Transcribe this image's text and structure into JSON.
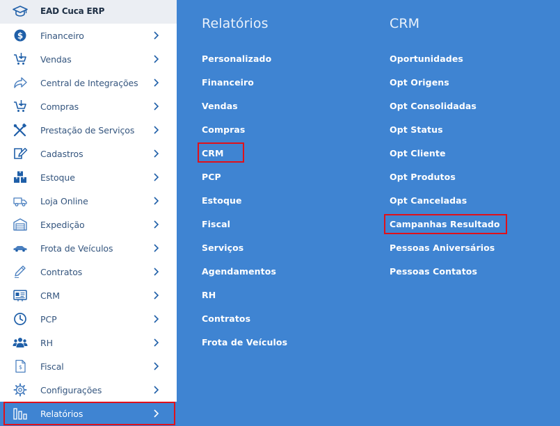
{
  "brand": {
    "title": "EAD Cuca ERP",
    "icon": "graduation-cap-icon"
  },
  "sidebar": {
    "items": [
      {
        "label": "Financeiro",
        "icon": "dollar-circle-icon"
      },
      {
        "label": "Vendas",
        "icon": "cart-arrow-icon"
      },
      {
        "label": "Central de Integrações",
        "icon": "share-arrow-icon"
      },
      {
        "label": "Compras",
        "icon": "cart-down-icon"
      },
      {
        "label": "Prestação de Serviços",
        "icon": "tools-icon"
      },
      {
        "label": "Cadastros",
        "icon": "edit-icon"
      },
      {
        "label": "Estoque",
        "icon": "boxes-icon"
      },
      {
        "label": "Loja Online",
        "icon": "truck-icon"
      },
      {
        "label": "Expedição",
        "icon": "warehouse-icon"
      },
      {
        "label": "Frota de Veículos",
        "icon": "car-icon"
      },
      {
        "label": "Contratos",
        "icon": "pen-icon"
      },
      {
        "label": "CRM",
        "icon": "id-card-icon"
      },
      {
        "label": "PCP",
        "icon": "clock-icon"
      },
      {
        "label": "RH",
        "icon": "users-icon"
      },
      {
        "label": "Fiscal",
        "icon": "document-dollar-icon"
      },
      {
        "label": "Configurações",
        "icon": "gear-icon"
      },
      {
        "label": "Relatórios",
        "icon": "bar-chart-icon"
      }
    ],
    "active": "Relatórios"
  },
  "relatorios": {
    "title": "Relatórios",
    "links": [
      "Personalizado",
      "Financeiro",
      "Vendas",
      "Compras",
      "CRM",
      "PCP",
      "Estoque",
      "Fiscal",
      "Serviços",
      "Agendamentos",
      "RH",
      "Contratos",
      "Frota de Veículos"
    ]
  },
  "crm": {
    "title": "CRM",
    "links": [
      "Oportunidades",
      "Opt Origens",
      "Opt Consolidadas",
      "Opt Status",
      "Opt Cliente",
      "Opt Produtos",
      "Opt Canceladas",
      "Campanhas Resultado",
      "Pessoas Aniversários",
      "Pessoas Contatos"
    ]
  },
  "colors": {
    "accent": "#3f84d2",
    "icon": "#1f5fa8",
    "highlight": "#e0101a"
  }
}
